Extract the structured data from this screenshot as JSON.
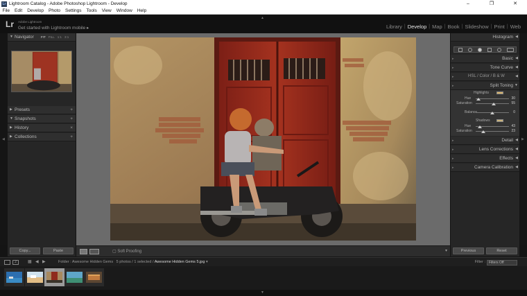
{
  "window": {
    "title": "Lightroom Catalog - Adobe Photoshop Lightroom - Develop",
    "minimize": "–",
    "maximize": "❐",
    "close": "✕"
  },
  "menu": [
    "File",
    "Edit",
    "Develop",
    "Photo",
    "Settings",
    "Tools",
    "View",
    "Window",
    "Help"
  ],
  "identity": {
    "logo": "Lr",
    "product": "Adobe Lightroom",
    "tagline": "Get started with Lightroom mobile",
    "tagline_arrow": "▸"
  },
  "modules": [
    "Library",
    "Develop",
    "Map",
    "Book",
    "Slideshow",
    "Print",
    "Web"
  ],
  "active_module": "Develop",
  "left_panel": {
    "navigator": "Navigator",
    "zoom": [
      "FIT",
      "FILL",
      "1:1",
      "3:1"
    ],
    "sections": [
      "Presets",
      "Snapshots",
      "History",
      "Collections"
    ],
    "copy_btn": "Copy...",
    "paste_btn": "Paste"
  },
  "toolbar": {
    "soft_proofing": "Soft Proofing"
  },
  "right_panel": {
    "histogram": "Histogram",
    "basic": "Basic",
    "tone_curve": "Tone Curve",
    "hsl": "HSL",
    "color": "Color",
    "bw": "B & W",
    "split_toning": "Split Toning",
    "highlights": {
      "label": "Highlights",
      "hue_label": "Hue",
      "hue": 30,
      "hue_fraction": 0.08,
      "sat_label": "Saturation",
      "sat": 55,
      "sat_fraction": 0.55
    },
    "balance": {
      "label": "Balance",
      "value": 0,
      "fraction": 0.5
    },
    "shadows": {
      "label": "Shadows",
      "hue_label": "Hue",
      "hue": 43,
      "hue_fraction": 0.12,
      "sat_label": "Saturation",
      "sat": 23,
      "sat_fraction": 0.23
    },
    "detail": "Detail",
    "lens": "Lens Corrections",
    "effects": "Effects",
    "calibration": "Camera Calibration",
    "previous_btn": "Previous",
    "reset_btn": "Reset"
  },
  "filmstrip": {
    "page1": "1",
    "page2": "2",
    "folder_prefix": "Folder : Awesome Hidden Gems",
    "counts": "5 photos / 1 selected /",
    "filename": "Awesome Hidden Gems 5.jpg",
    "filename_arrow": "▾",
    "filter_label": "Filter :",
    "filter_value": "Filters Off"
  },
  "colors": {
    "highlight_swatch": "#d9b46a",
    "shadow_swatch": "#c9b27a"
  }
}
